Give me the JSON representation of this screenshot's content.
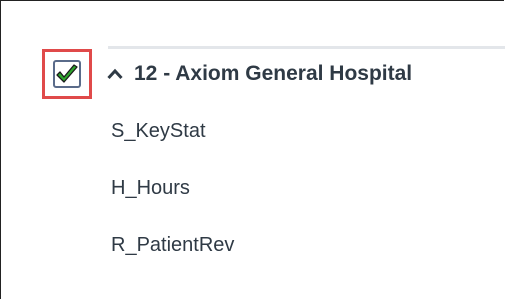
{
  "group": {
    "title": "12 - Axiom General Hospital",
    "checked": true,
    "expanded": true,
    "checkbox_highlight_color": "#e04a4a",
    "check_color": "#2ea52e"
  },
  "children": [
    {
      "label": "S_KeyStat"
    },
    {
      "label": "H_Hours"
    },
    {
      "label": "R_PatientRev"
    }
  ],
  "icons": {
    "checkbox": "checkmark-icon",
    "toggle": "chevron-up-icon"
  }
}
